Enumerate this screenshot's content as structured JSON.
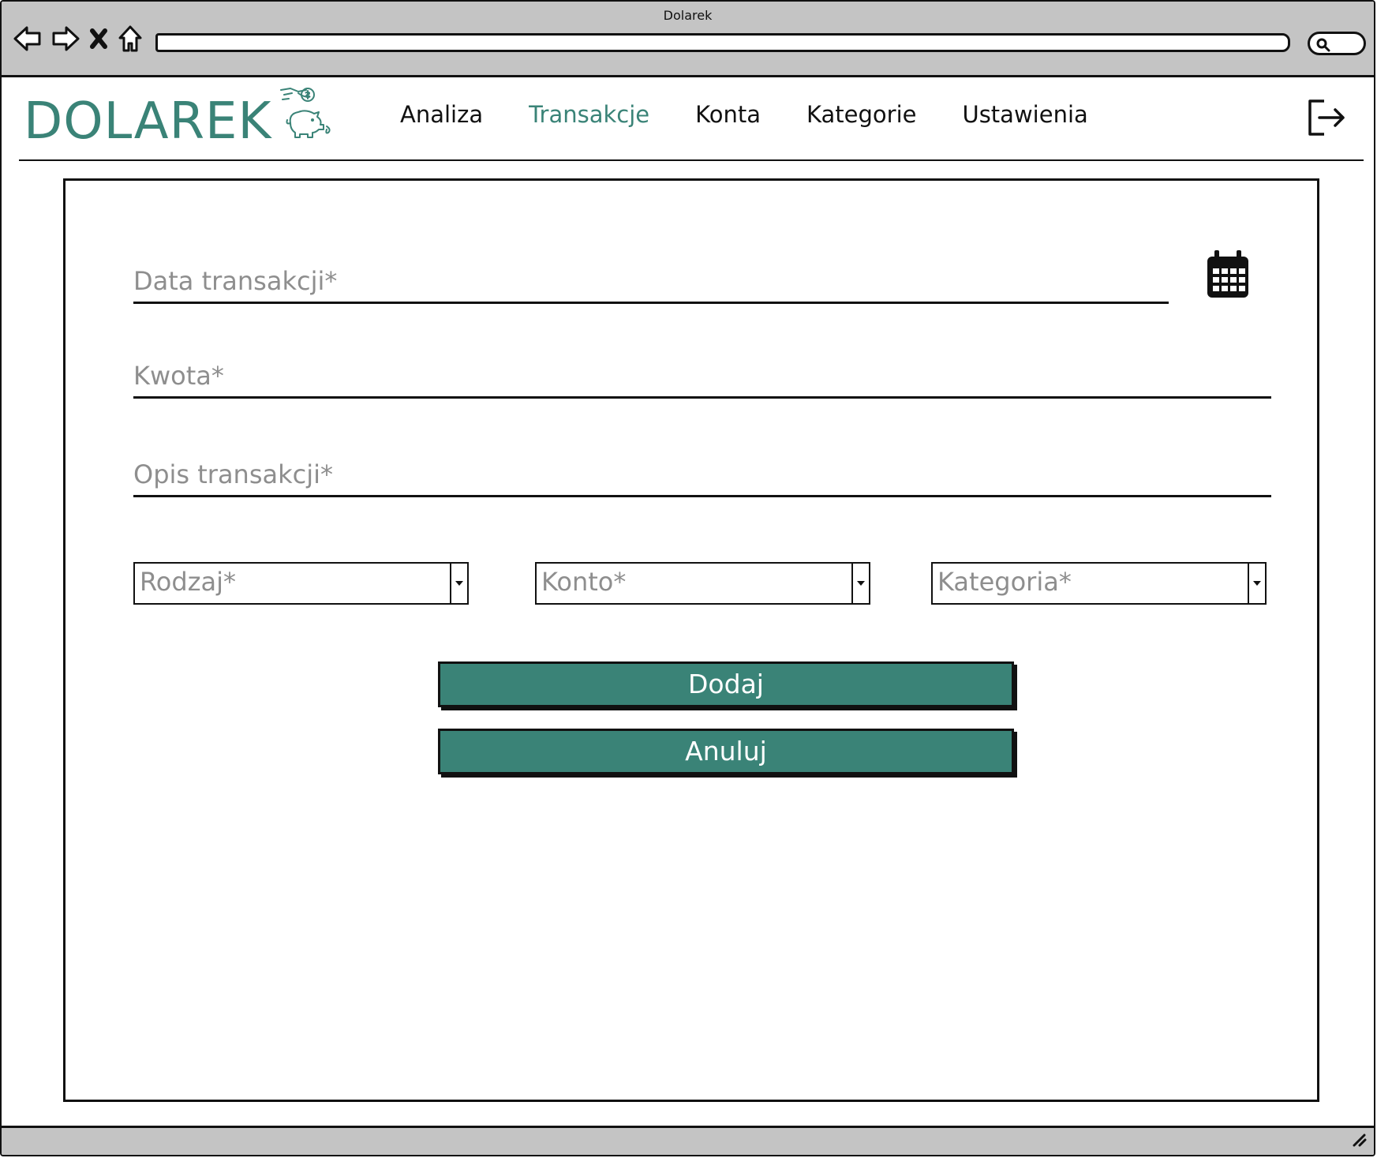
{
  "window": {
    "title": "Dolarek"
  },
  "browser": {
    "icons": [
      "back-arrow-icon",
      "forward-arrow-icon",
      "close-x-icon",
      "home-icon",
      "search-icon"
    ]
  },
  "header": {
    "logo_text": "DOLAREK",
    "logo_icon": "piggy-bank-coin-icon",
    "nav": [
      {
        "label": "Analiza",
        "active": false
      },
      {
        "label": "Transakcje",
        "active": true
      },
      {
        "label": "Konta",
        "active": false
      },
      {
        "label": "Kategorie",
        "active": false
      },
      {
        "label": "Ustawienia",
        "active": false
      }
    ],
    "logout_icon": "logout-icon"
  },
  "form": {
    "date_placeholder": "Data transakcji*",
    "date_value": "",
    "amount_placeholder": "Kwota*",
    "amount_value": "",
    "description_placeholder": "Opis transakcji*",
    "description_value": "",
    "calendar_icon": "calendar-icon",
    "type_select": "Rodzaj*",
    "account_select": "Konto*",
    "category_select": "Kategoria*",
    "add_button": "Dodaj",
    "cancel_button": "Anuluj"
  },
  "colors": {
    "accent": "#3a8377",
    "chrome": "#c4c4c4",
    "placeholder": "#8e8e8e",
    "text": "#111111"
  }
}
